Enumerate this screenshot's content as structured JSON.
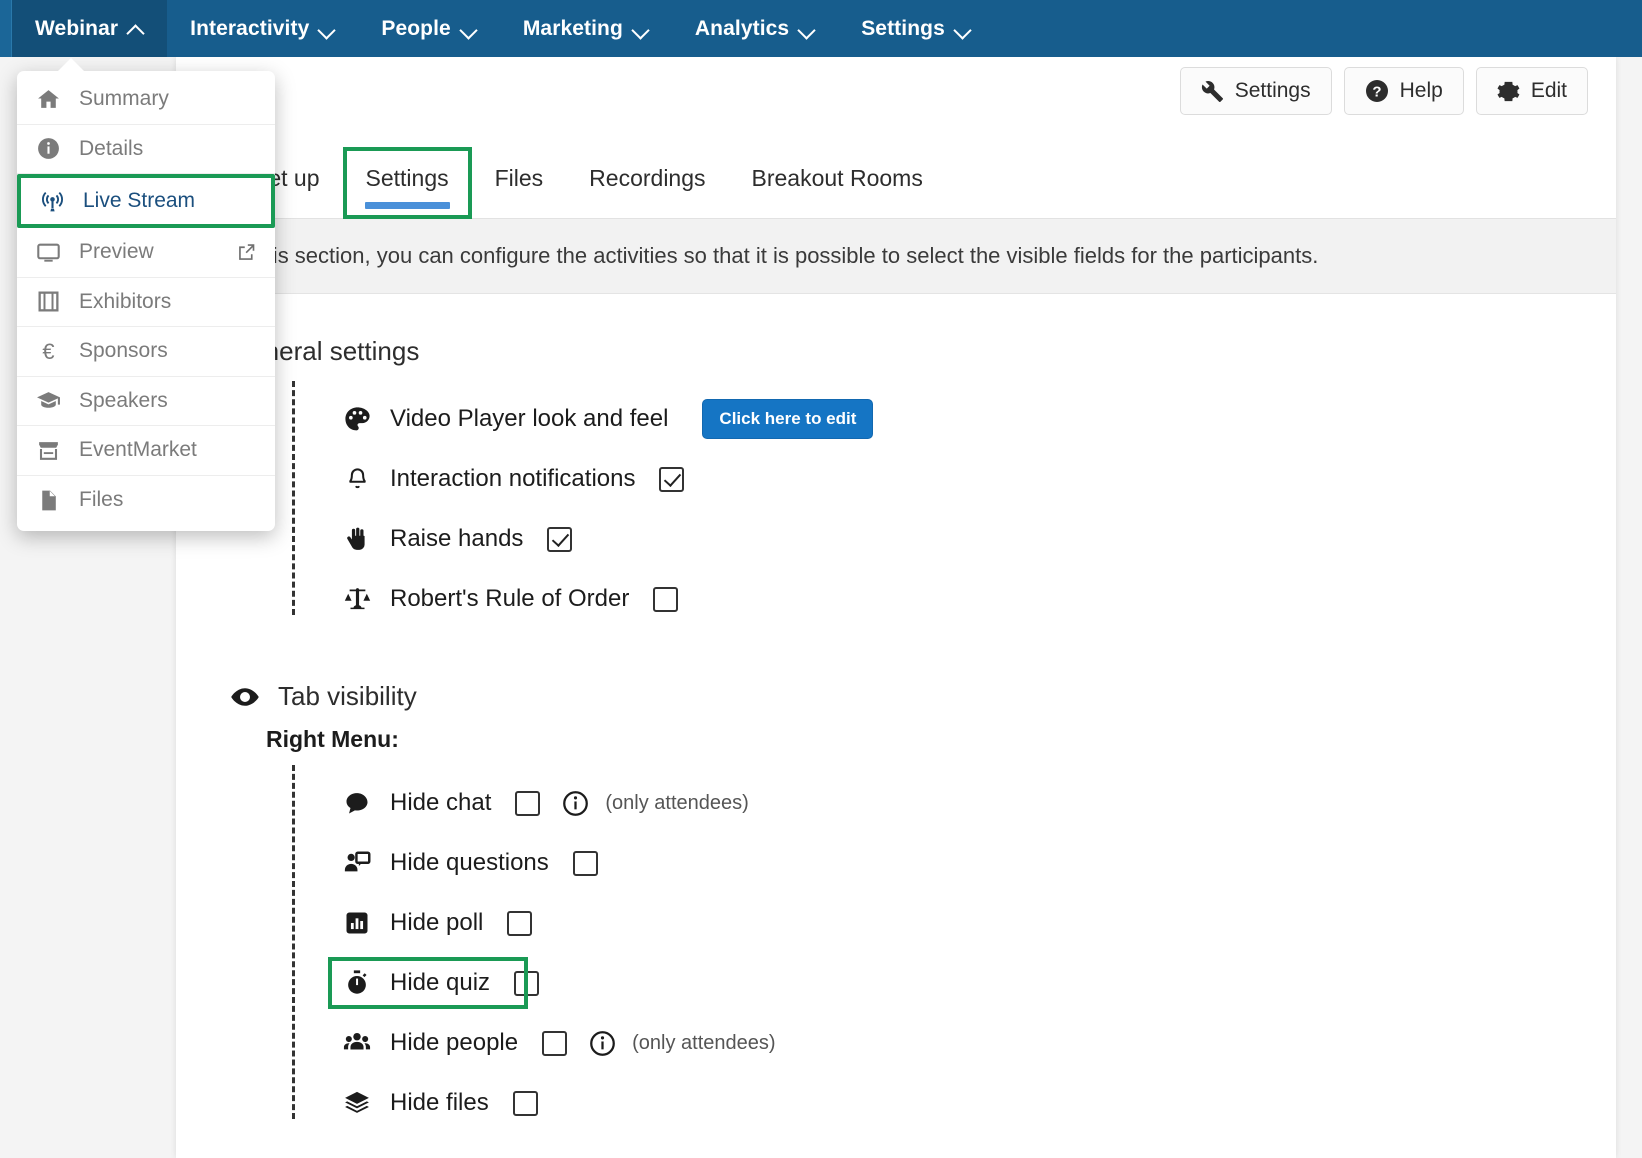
{
  "navbar": {
    "items": [
      {
        "label": "Webinar",
        "caret": "chevron-up-icon",
        "active": true
      },
      {
        "label": "Interactivity",
        "caret": "chevron-down-icon",
        "active": false
      },
      {
        "label": "People",
        "caret": "chevron-down-icon",
        "active": false
      },
      {
        "label": "Marketing",
        "caret": "chevron-down-icon",
        "active": false
      },
      {
        "label": "Analytics",
        "caret": "chevron-down-icon",
        "active": false
      },
      {
        "label": "Settings",
        "caret": "chevron-down-icon",
        "active": false
      }
    ]
  },
  "dropdown": {
    "items": [
      {
        "label": "Summary",
        "icon": "home-icon"
      },
      {
        "label": "Details",
        "icon": "info-circle-icon"
      },
      {
        "label": "Live Stream",
        "icon": "broadcast-icon",
        "highlighted": true
      },
      {
        "label": "Preview",
        "icon": "monitor-icon",
        "external": "external-link-icon"
      },
      {
        "label": "Exhibitors",
        "icon": "book-icon"
      },
      {
        "label": "Sponsors",
        "icon": "euro-icon"
      },
      {
        "label": "Speakers",
        "icon": "graduation-cap-icon"
      },
      {
        "label": "EventMarket",
        "icon": "store-icon"
      },
      {
        "label": "Files",
        "icon": "file-icon"
      }
    ]
  },
  "actions": [
    {
      "label": "Settings",
      "icon": "wrench-icon"
    },
    {
      "label": "Help",
      "icon": "question-circle-icon"
    },
    {
      "label": "Edit",
      "icon": "gear-icon"
    }
  ],
  "tabs": [
    {
      "label": "Set up",
      "active": false,
      "highlighted": false
    },
    {
      "label": "Settings",
      "active": true,
      "highlighted": true
    },
    {
      "label": "Files",
      "active": false,
      "highlighted": false
    },
    {
      "label": "Recordings",
      "active": false,
      "highlighted": false
    },
    {
      "label": "Breakout Rooms",
      "active": false,
      "highlighted": false
    }
  ],
  "banner": {
    "text": "In this section, you can configure the activities so that it is possible to select the visible fields for the participants."
  },
  "general_settings": {
    "title": "General settings",
    "rows": [
      {
        "label": "Video Player look and feel",
        "icon": "palette-icon",
        "control": "button",
        "button_label": "Click here to edit"
      },
      {
        "label": "Interaction notifications",
        "icon": "bell-icon",
        "control": "checkbox",
        "checked": true
      },
      {
        "label": "Raise hands",
        "icon": "hand-icon",
        "control": "checkbox",
        "checked": true
      },
      {
        "label": "Robert's Rule of Order",
        "icon": "scales-icon",
        "control": "checkbox",
        "checked": false
      }
    ]
  },
  "tab_visibility": {
    "title": "Tab visibility",
    "icon": "eye-icon",
    "subhead": "Right Menu:",
    "rows": [
      {
        "label": "Hide chat",
        "icon": "chat-icon",
        "checked": false,
        "hint": "(only attendees)",
        "info": true,
        "highlighted": false
      },
      {
        "label": "Hide questions",
        "icon": "question-person-icon",
        "checked": false,
        "hint": "",
        "info": false,
        "highlighted": false
      },
      {
        "label": "Hide poll",
        "icon": "poll-icon",
        "checked": false,
        "hint": "",
        "info": false,
        "highlighted": false
      },
      {
        "label": "Hide quiz",
        "icon": "stopwatch-icon",
        "checked": false,
        "hint": "",
        "info": false,
        "highlighted": true
      },
      {
        "label": "Hide people",
        "icon": "people-icon",
        "checked": false,
        "hint": "(only attendees)",
        "info": true,
        "highlighted": false
      },
      {
        "label": "Hide files",
        "icon": "layers-icon",
        "checked": false,
        "hint": "",
        "info": false,
        "highlighted": false
      }
    ]
  },
  "colors": {
    "navbar": "#175d8d",
    "navbar_active": "#134f78",
    "highlight_green": "#1a9a55",
    "tab_underline": "#4a90d9",
    "primary_button": "#1575c4",
    "link_blue": "#1b4f7e"
  }
}
